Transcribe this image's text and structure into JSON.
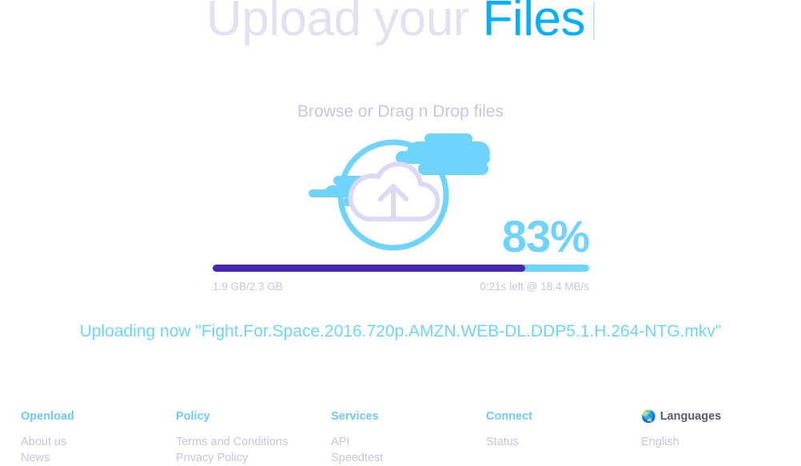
{
  "hero": {
    "word_faded": "Upload your",
    "word_accent": "Files"
  },
  "browse": {
    "text": "Browse or Drag n Drop files"
  },
  "upload": {
    "icon_name": "cloud-upload-icon",
    "percent": "83%",
    "percent_value": 83,
    "size_progress": "1.9 GB/2.3 GB",
    "time_and_speed": "0:21s left @ 18.4 MB/s",
    "status": "Uploading now \"Fight.For.Space.2016.720p.AMZN.WEB-DL.DDP5.1.H.264-NTG.mkv\"",
    "colors": {
      "fill": "#4527b0",
      "track": "#6fd4fb",
      "accent": "#6fd4fb"
    }
  },
  "footer": {
    "columns": [
      {
        "heading": "Openload",
        "links": [
          "About us",
          "News"
        ]
      },
      {
        "heading": "Policy",
        "links": [
          "Terms and Conditions",
          "Privacy Policy"
        ]
      },
      {
        "heading": "Services",
        "links": [
          "API",
          "Speedtest"
        ]
      },
      {
        "heading": "Connect",
        "links": [
          "Status"
        ]
      },
      {
        "heading": "Languages",
        "icon": "globe-icon",
        "glyph": "🌏",
        "links": [
          "English"
        ]
      }
    ]
  }
}
